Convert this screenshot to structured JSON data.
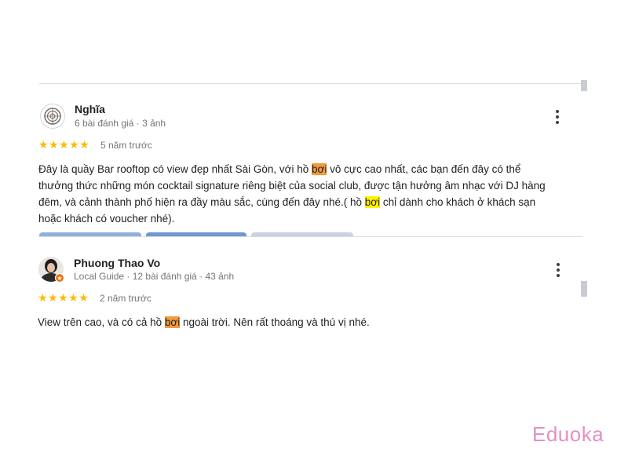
{
  "reviews": [
    {
      "name": "Nghĩa",
      "meta": "6 bài đánh giá · 3 ảnh",
      "stars": "★★★★★",
      "time": "5 năm trước",
      "text_segments": [
        {
          "t": "Đây là quầy Bar rooftop có view đẹp nhất Sài Gòn, với hồ "
        },
        {
          "t": "bơi",
          "hl": "orange"
        },
        {
          "t": " vô cực cao nhất, các bạn đến đây có thể thưởng thức những món cocktail signature riêng biệt của social club, được tận hưởng âm nhạc với DJ hàng đêm, và cảnh thành phố hiện ra đầy màu sắc, cùng đến đây nhé.( hồ "
        },
        {
          "t": "bơi",
          "hl": "yellow"
        },
        {
          "t": " chỉ dành cho khách ở khách sạn hoặc khách có voucher nhé)."
        }
      ]
    },
    {
      "name": "Phuong Thao Vo",
      "meta": "Local Guide · 12 bài đánh giá · 43 ảnh",
      "stars": "★★★★★",
      "time": "2 năm trước",
      "text_segments": [
        {
          "t": "View trên cao, và có cả hồ "
        },
        {
          "t": "bơi",
          "hl": "orange"
        },
        {
          "t": " ngoài trời. Nên rất thoáng và thú vị nhé."
        }
      ]
    }
  ],
  "watermark": "Eduoka",
  "colors": {
    "star": "#fbbc04",
    "highlight_orange": "#f39a3d",
    "highlight_yellow": "#fff000",
    "watermark": "#e58fc7"
  },
  "icons": {
    "menu": "more-vert-icon",
    "avatar1": "circular-emblem-avatar",
    "avatar2": "profile-photo-avatar",
    "local_guide_badge": "local-guide-star-badge"
  }
}
